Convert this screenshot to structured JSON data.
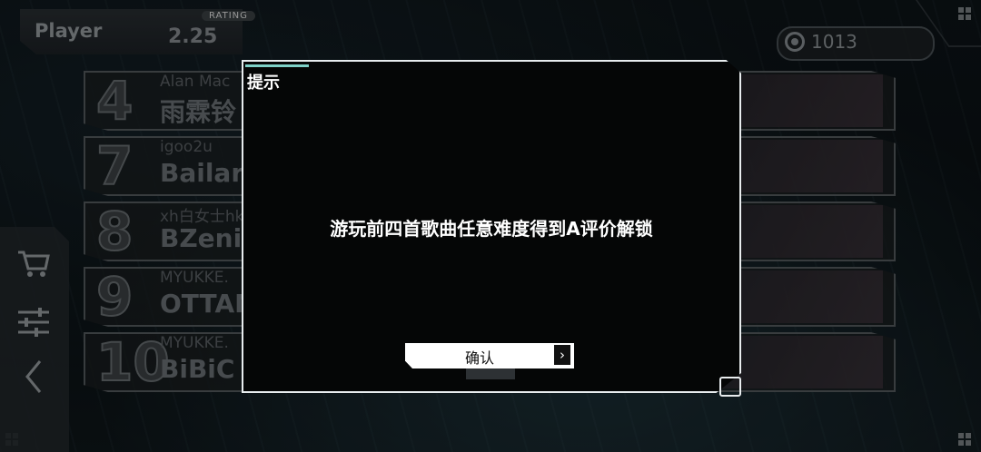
{
  "player": {
    "name": "Player",
    "rating_label": "RATING",
    "rating_value": "2.25"
  },
  "currency": {
    "icon": "coin-icon",
    "value": "1013"
  },
  "songs": [
    {
      "number": "4",
      "artist": "Alan Mac",
      "title": "雨霖铃"
    },
    {
      "number": "7",
      "artist": "igoo2u",
      "title": "Bailar"
    },
    {
      "number": "8",
      "artist": "xh白女士hk",
      "title": "BZenith"
    },
    {
      "number": "9",
      "artist": "MYUKKE.",
      "title": "OTTAMA GAZER"
    },
    {
      "number": "10",
      "artist": "MYUKKE.",
      "title": "BiBiC Heart"
    }
  ],
  "side_menu": {
    "shop_icon": "cart-icon",
    "settings_icon": "sliders-icon",
    "back_icon": "chevron-left-icon"
  },
  "dialog": {
    "title": "提示",
    "message": "游玩前四首歌曲任意难度得到A评价解锁",
    "confirm_label": "确认",
    "confirm_icon": "chevron-right-icon"
  },
  "colors": {
    "accent": "#7fd1c8",
    "dialog_border": "#e8ecee",
    "dialog_bg": "#050606"
  }
}
